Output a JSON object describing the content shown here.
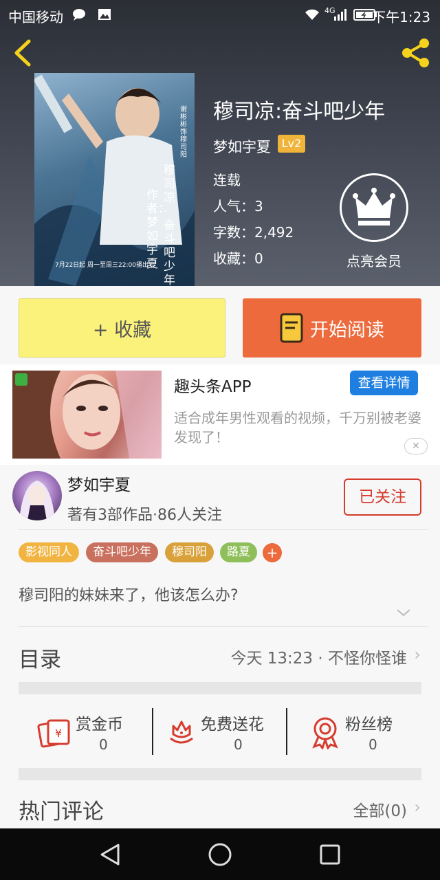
{
  "status_bar": {
    "carrier": "中国移动",
    "time": "下午1:23",
    "network": "4G"
  },
  "book": {
    "title": "穆司凉:奋斗吧少年",
    "author": "梦如宇夏",
    "level": "Lv2",
    "status": "连载",
    "popularity": "人气：3",
    "word_count": "字数：2,492",
    "favorites": "收藏：0",
    "vip_label": "点亮会员",
    "cover": {
      "side_title": "穆司凉·奋斗吧少年",
      "side_author": "作者：梦如宇夏",
      "small": "谢彬彬 饰 穆司阳",
      "schedule": "7月22日起 周一至周三22:00播出"
    }
  },
  "actions": {
    "collect": "+ 收藏",
    "read": "开始阅读"
  },
  "ad": {
    "title": "趣头条APP",
    "button": "查看详情",
    "description": "适合成年男性观看的视频，千万别被老婆发现了！",
    "close": "✕"
  },
  "author_card": {
    "name": "梦如宇夏",
    "stats": "著有3部作品·86人关注",
    "follow_button": "已关注"
  },
  "tags": [
    {
      "label": "影视同人",
      "color": "#f2b441"
    },
    {
      "label": "奋斗吧少年",
      "color": "#c9705e"
    },
    {
      "label": "穆司阳",
      "color": "#d9a13a"
    },
    {
      "label": "路夏",
      "color": "#8fbf5a"
    }
  ],
  "tag_add": "+",
  "description": "穆司阳的妹妹来了，他该怎么办?",
  "catalog": {
    "label": "目录",
    "latest": "今天 13:23 · 不怪你怪谁"
  },
  "rewards": [
    {
      "label": "赏金币",
      "value": "0",
      "icon": "red-envelope-icon"
    },
    {
      "label": "免费送花",
      "value": "0",
      "icon": "flower-icon"
    },
    {
      "label": "粉丝榜",
      "value": "0",
      "icon": "medal-icon"
    }
  ],
  "comments": {
    "label": "热门评论",
    "all": "全部(0)"
  },
  "colors": {
    "accent_orange": "#ec6a3b",
    "collect_yellow": "#fbf27c",
    "follow_red": "#d63c2e",
    "ad_blue": "#1e7fe0",
    "level_gold": "#f0b43a"
  }
}
